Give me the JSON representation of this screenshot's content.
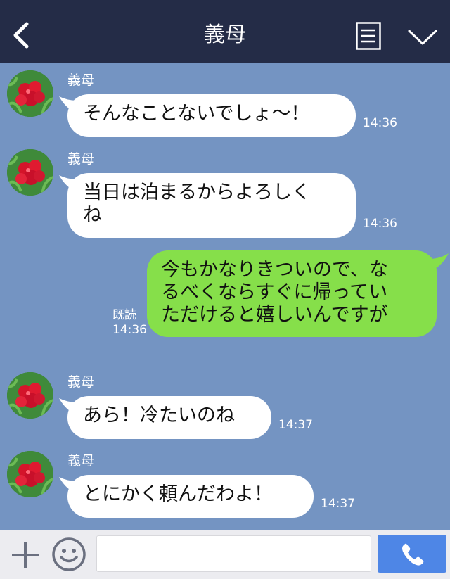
{
  "header": {
    "title": "義母",
    "back_icon": "chevron-left-icon",
    "menu_icon": "menu-lines-icon",
    "collapse_icon": "chevron-down-icon"
  },
  "messages": [
    {
      "side": "in",
      "sender": "義母",
      "text": "そんなことないでしょ〜！",
      "time": "14:36"
    },
    {
      "side": "in",
      "sender": "義母",
      "text_lines": [
        "当日は泊まるからよろしく",
        "ね"
      ],
      "time": "14:36"
    },
    {
      "side": "out",
      "text_lines": [
        "今もかなりきついので、な",
        "るべくならすぐに帰ってい",
        "ただけると嬉しいんですが"
      ],
      "read": "既読",
      "time": "14:36"
    },
    {
      "side": "in",
      "sender": "義母",
      "text": "あら！冷たいのね",
      "time": "14:37"
    },
    {
      "side": "in",
      "sender": "義母",
      "text": "とにかく頼んだわよ！",
      "time": "14:37"
    }
  ],
  "input_bar": {
    "plus_icon": "plus-icon",
    "emoji_icon": "smiley-icon",
    "input_value": "",
    "call_icon": "phone-icon"
  },
  "colors": {
    "header_bg": "#242c47",
    "chat_bg": "#7494c2",
    "incoming_bubble": "#ffffff",
    "outgoing_bubble": "#86df4a",
    "call_button": "#4e86e6"
  }
}
